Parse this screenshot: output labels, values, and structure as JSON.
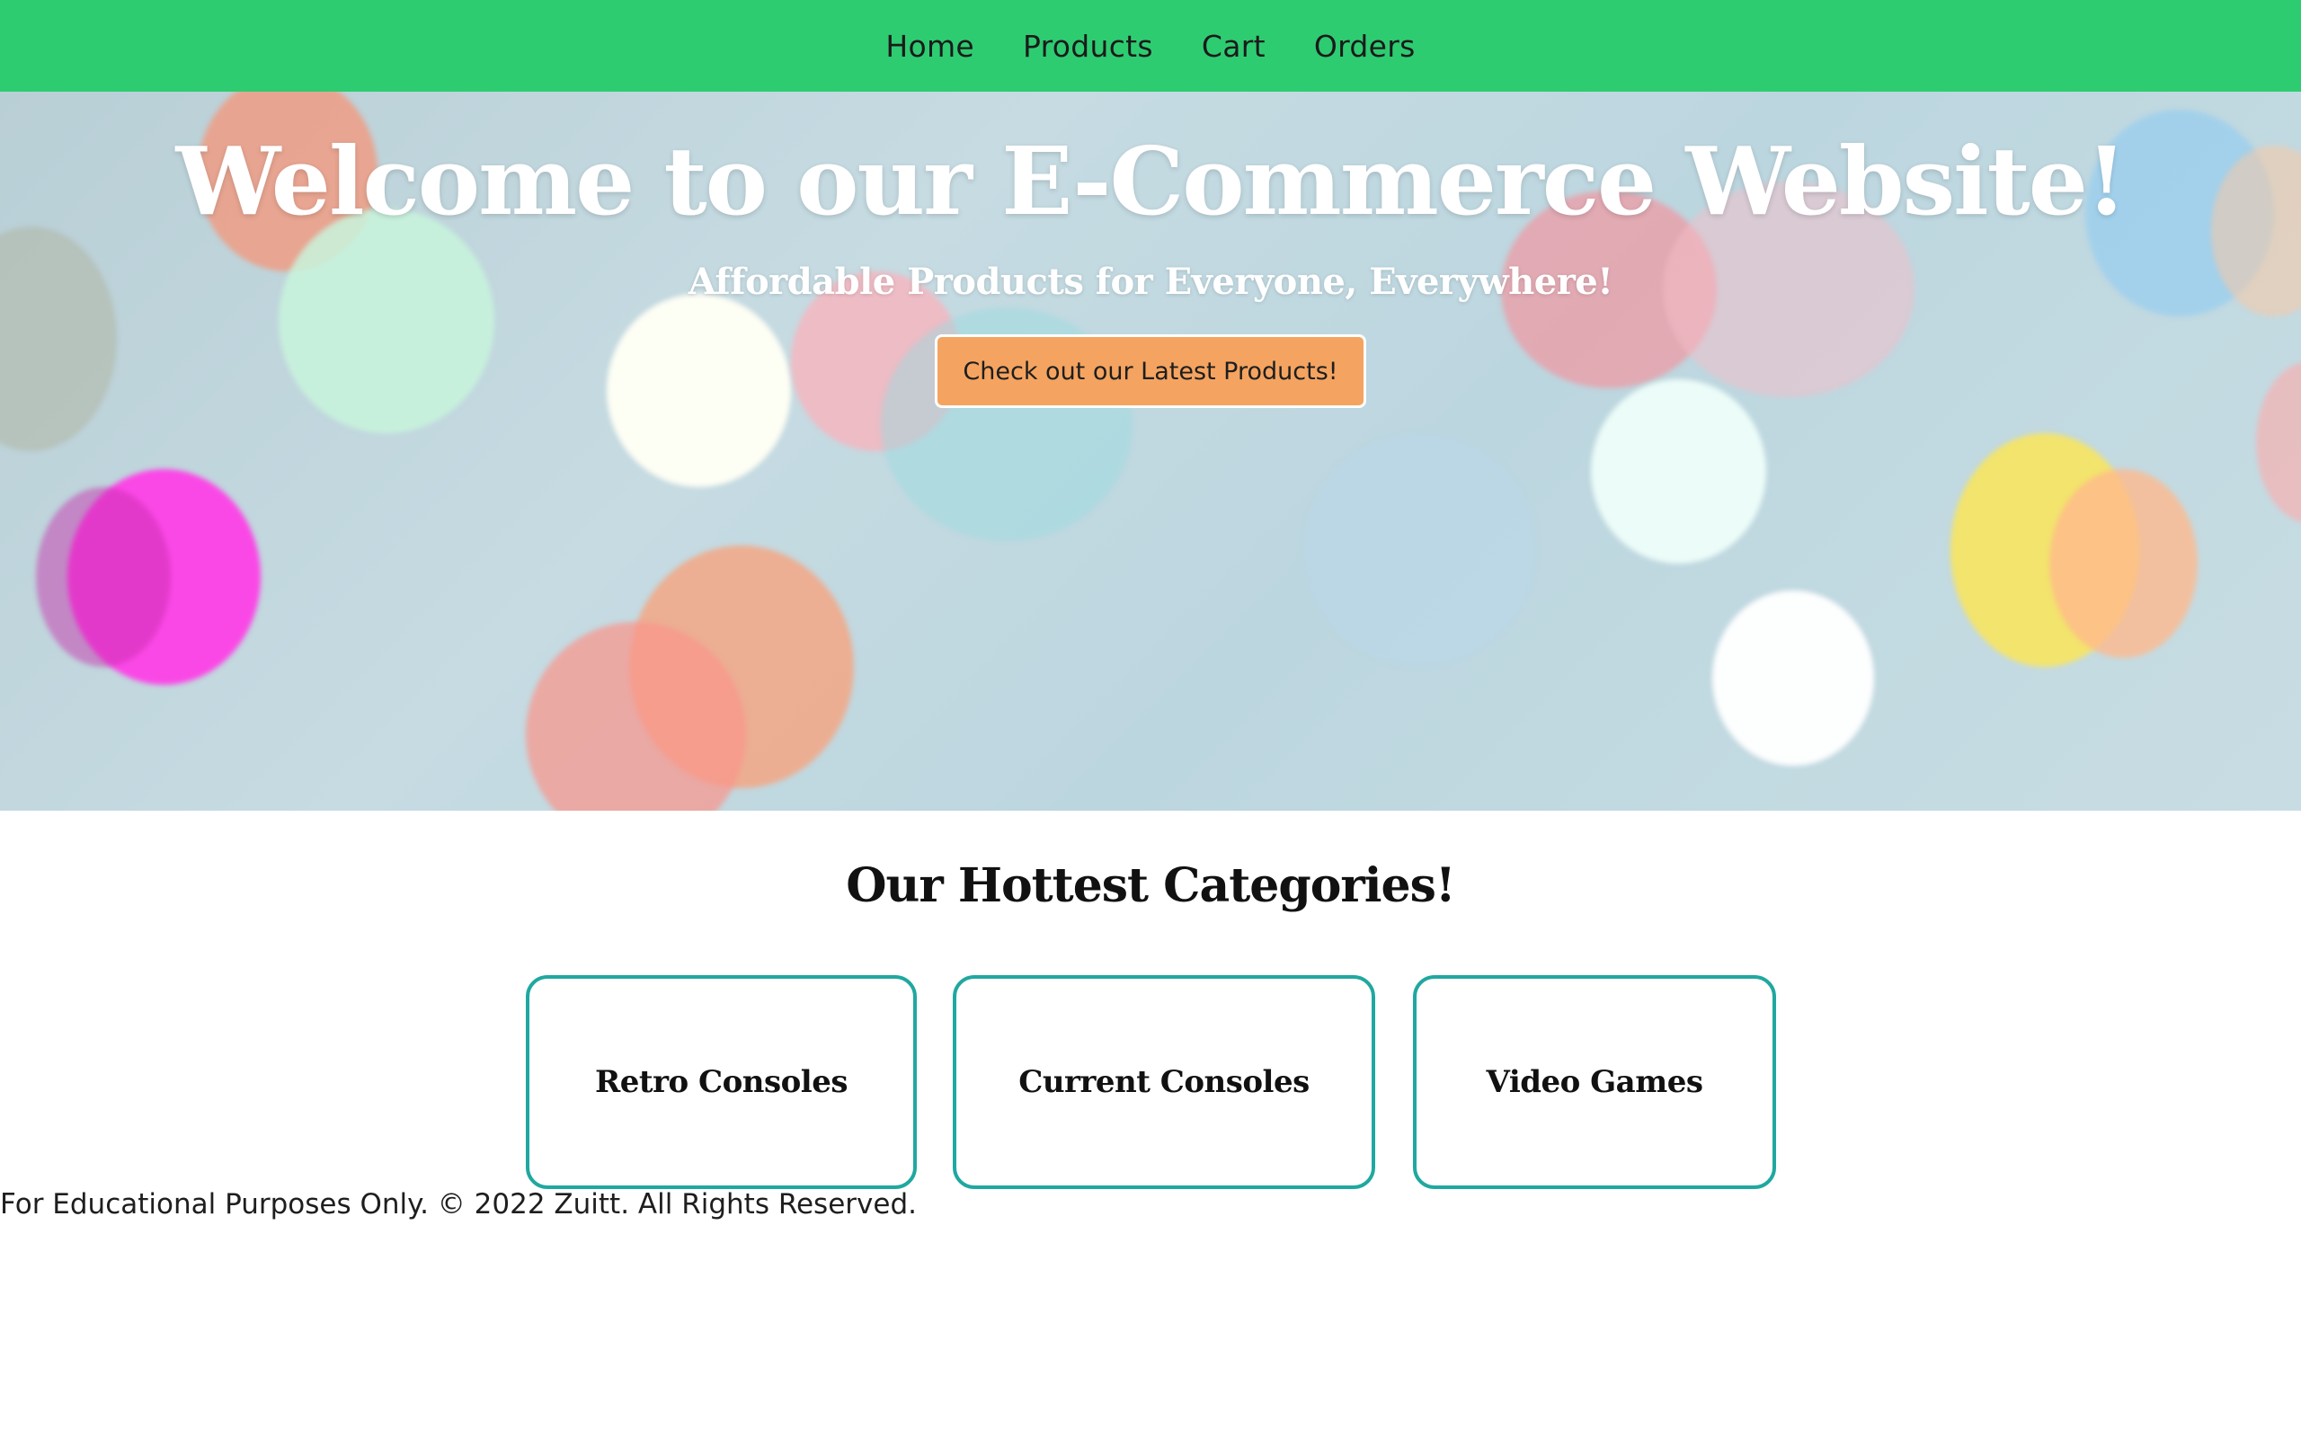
{
  "navbar": {
    "links": [
      {
        "label": "Home"
      },
      {
        "label": "Products"
      },
      {
        "label": "Cart"
      },
      {
        "label": "Orders"
      }
    ],
    "background_color": "#2ecc71"
  },
  "hero": {
    "title": "Welcome to our E-Commerce Website!",
    "subtitle": "Affordable Products for Everyone, Everywhere!",
    "cta_label": "Check out our Latest Products!",
    "cta_color": "#f4a460"
  },
  "categories": {
    "title": "Our Hottest Categories!",
    "items": [
      {
        "label": "Retro Consoles"
      },
      {
        "label": "Current Consoles"
      },
      {
        "label": "Video Games"
      }
    ],
    "border_color": "#20a8a0"
  },
  "footer": {
    "text": "For Educational Purposes Only. © 2022 Zuitt. All Rights Reserved."
  }
}
